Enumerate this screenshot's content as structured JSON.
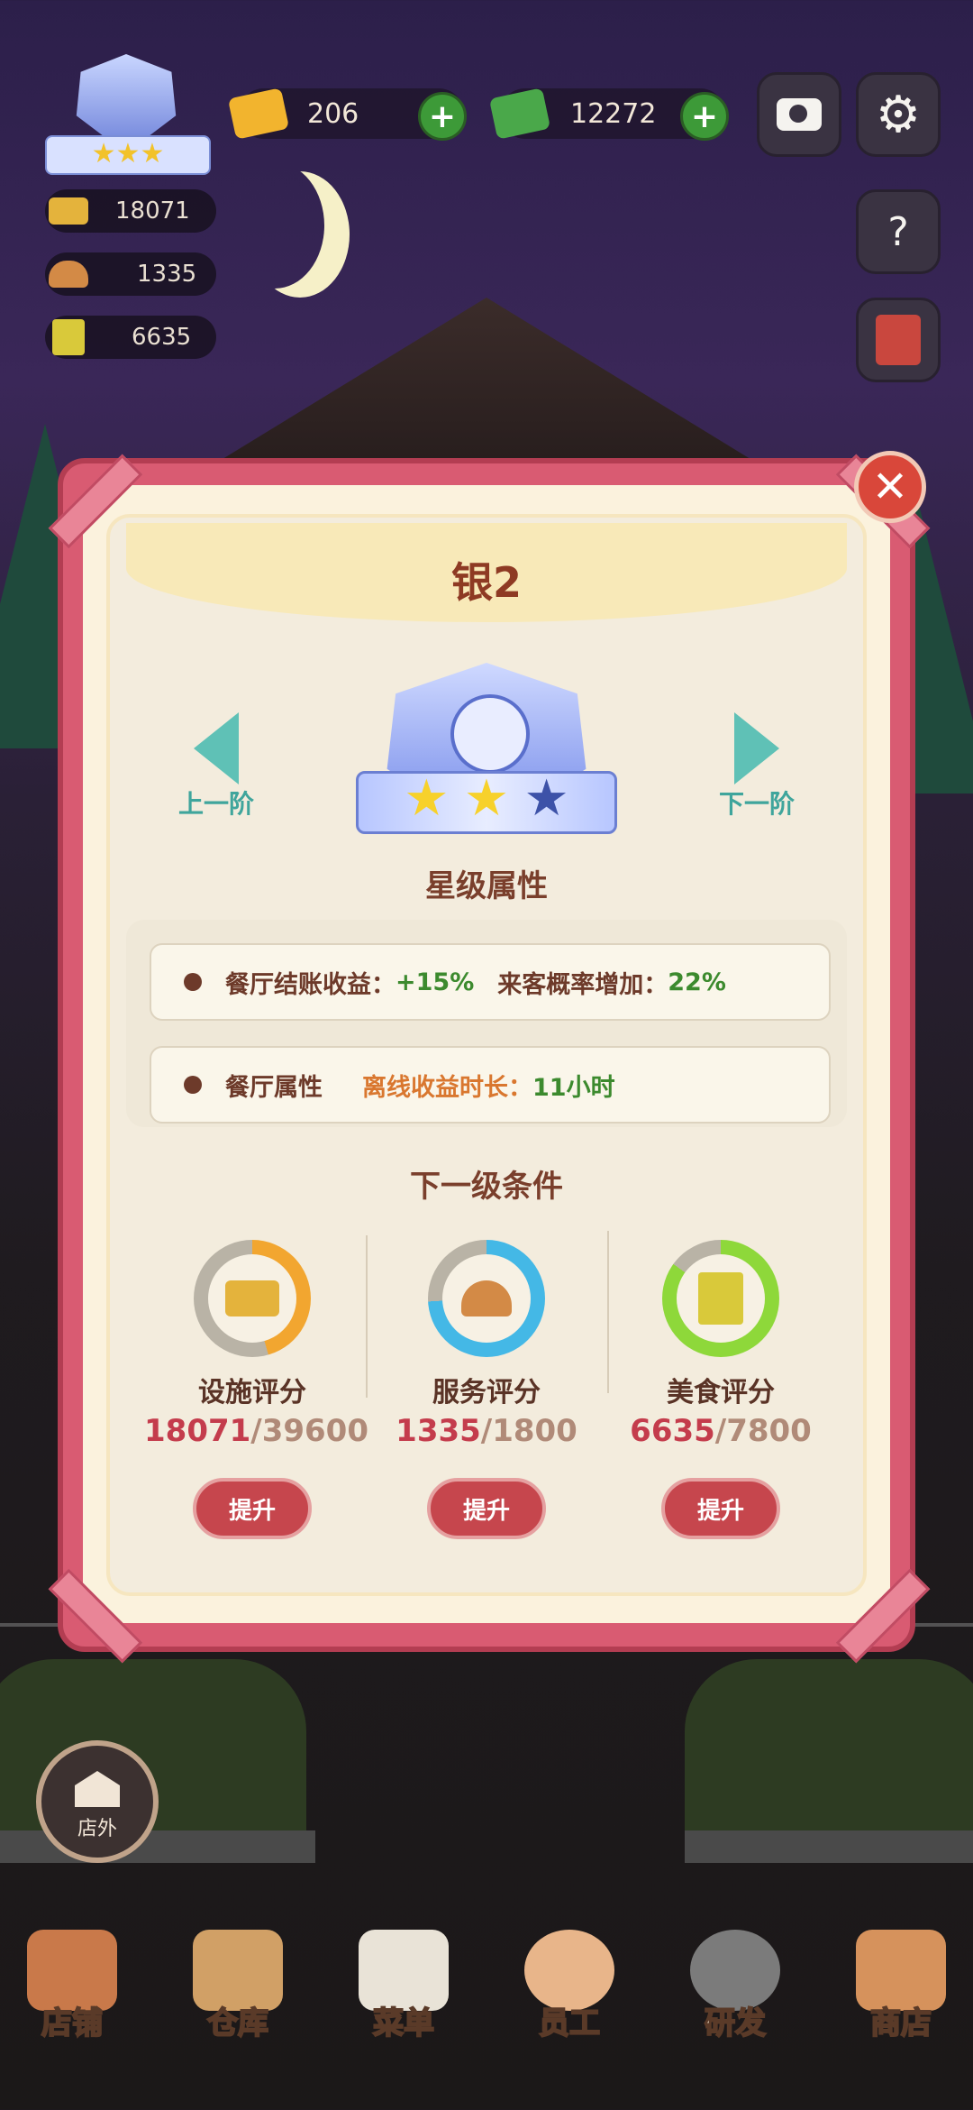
{
  "hud": {
    "gems": "206",
    "cash": "12272",
    "rank_stats": [
      {
        "icon": "facility-icon",
        "value": "18071"
      },
      {
        "icon": "service-icon",
        "value": "1335"
      },
      {
        "icon": "food-book-icon",
        "value": "6635"
      }
    ]
  },
  "modal": {
    "title": "银2",
    "prev_label": "上一阶",
    "next_label": "下一阶",
    "stars_filled": 2,
    "stars_total": 3,
    "star_section_title": "星级属性",
    "attr1_label": "餐厅结账收益：",
    "attr1_value": "+15%",
    "attr1b_label": "来客概率增加：",
    "attr1b_value": "22%",
    "attr2_label": "餐厅属性",
    "attr2b_label": "离线收益时长：",
    "attr2b_value": "11小时",
    "next_section_title": "下一级条件",
    "conditions": [
      {
        "label": "设施评分",
        "current": "18071",
        "max": "/39600",
        "progress": 0.456,
        "color": "#f2a630",
        "button": "提升"
      },
      {
        "label": "服务评分",
        "current": "1335",
        "max": "/1800",
        "progress": 0.742,
        "color": "#44b8e6",
        "button": "提升"
      },
      {
        "label": "美食评分",
        "current": "6635",
        "max": "/7800",
        "progress": 0.851,
        "color": "#8ed83a",
        "button": "提升"
      }
    ]
  },
  "outside_label": "店外",
  "tabs": [
    "店铺",
    "仓库",
    "菜单",
    "员工",
    "研发",
    "商店"
  ],
  "colors": {
    "accent_green": "#3fa59c",
    "modal_border": "#d95b72",
    "button_red": "#c6464d"
  }
}
